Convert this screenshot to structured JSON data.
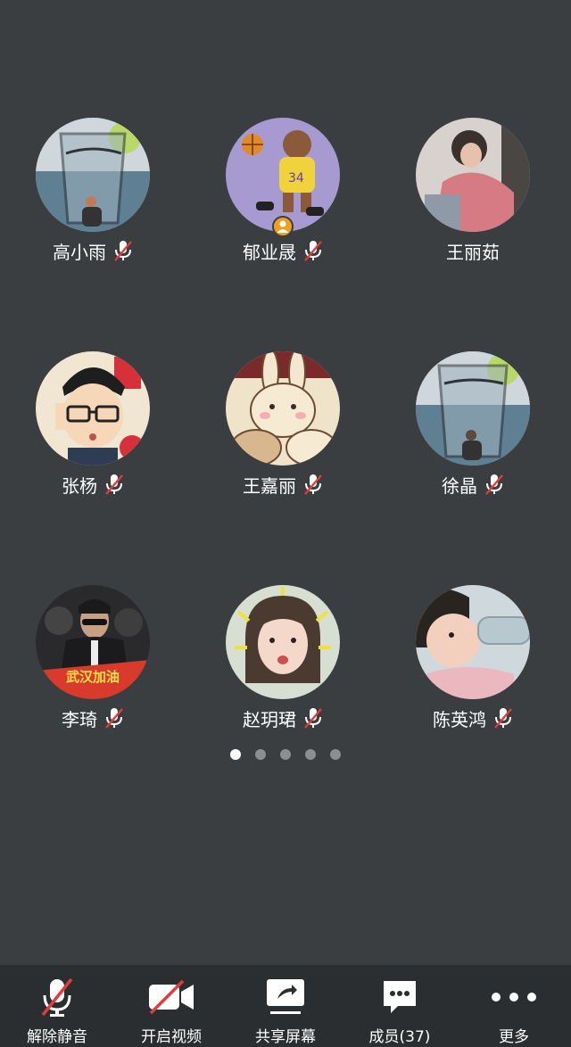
{
  "participants": [
    {
      "name": "高小雨",
      "muted": true,
      "avatar": "glass-sea-avatar"
    },
    {
      "name": "郁业晟",
      "muted": true,
      "avatar": "basketball-cartoon-avatar",
      "host": true
    },
    {
      "name": "王丽茹",
      "muted": false,
      "avatar": "woman-photo-avatar"
    },
    {
      "name": "张杨",
      "muted": true,
      "avatar": "cartoon-glasses-avatar"
    },
    {
      "name": "王嘉丽",
      "muted": true,
      "avatar": "bunny-cartoon-avatar"
    },
    {
      "name": "徐晶",
      "muted": true,
      "avatar": "glass-sea-avatar"
    },
    {
      "name": "李琦",
      "muted": true,
      "avatar": "man-sunglasses-avatar"
    },
    {
      "name": "赵玥珺",
      "muted": true,
      "avatar": "girl-photo-avatar"
    },
    {
      "name": "陈英鸿",
      "muted": true,
      "avatar": "child-drinking-avatar"
    }
  ],
  "avatar_banner_text": "武汉加油",
  "pagination": {
    "total_pages": 5,
    "current_page": 1
  },
  "toolbar": {
    "unmute_label": "解除静音",
    "start_video_label": "开启视频",
    "share_screen_label": "共享屏幕",
    "members_label": "成员(37)",
    "more_label": "更多"
  },
  "colors": {
    "background": "#3a3e41",
    "toolbar_bg": "#2b2e30",
    "muted_slash": "#e03c3c",
    "host_badge": "#f0a020"
  }
}
